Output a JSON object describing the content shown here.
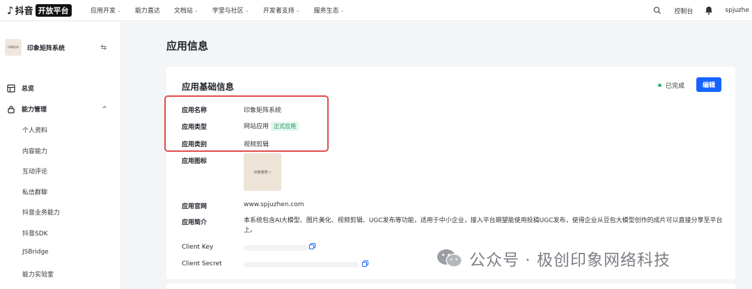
{
  "topbar": {
    "logo_note": "♪",
    "brand": "抖音",
    "platform": "开放平台",
    "nav": [
      {
        "label": "应用开发",
        "has_menu": true
      },
      {
        "label": "能力直达",
        "has_menu": false
      },
      {
        "label": "文档站",
        "has_menu": true
      },
      {
        "label": "学堂与社区",
        "has_menu": true
      },
      {
        "label": "开发者支持",
        "has_menu": true
      },
      {
        "label": "服务生态",
        "has_menu": true
      }
    ],
    "search_icon": "search-icon",
    "console": "控制台",
    "user": "spjuzhe"
  },
  "sidebar": {
    "app_thumb_text": "印象矩阵",
    "app_name": "印象矩阵系统",
    "overview": "总览",
    "group": "能力管理",
    "collapse_glyph": "^",
    "items": [
      "个人资料",
      "内容能力",
      "互动评论",
      "私信群聊",
      "抖音业务能力",
      "抖音SDK",
      "JSBridge",
      "能力实验室"
    ]
  },
  "main": {
    "page_title": "应用信息",
    "section_title": "应用基础信息",
    "status": "已完成",
    "status_color": "#2fb46e",
    "edit_button": "编辑",
    "accent_color": "#1664ff",
    "fields": {
      "name_label": "应用名称",
      "name_value": "印象矩阵系统",
      "type_label": "应用类型",
      "type_value": "网站应用",
      "type_tag": "正式应用",
      "category_label": "应用类别",
      "category_value": "视频剪辑",
      "icon_label": "应用图标",
      "icon_text": "印象矩阵 ♪",
      "site_label": "应用官网",
      "site_value": "www.spjuzhen.com",
      "intro_label": "应用简介",
      "intro_value": "本系统包含AI大模型、图片美化、视频剪辑、UGC发布等功能，适用于中小企业，接入平台期望能使用投稿UGC发布，使得企业从豆包大模型创作的成片可以直接分享至平台上。",
      "key_label": "Client Key",
      "secret_label": "Client Secret"
    },
    "highlight_color": "#e04a4a"
  },
  "watermark": {
    "text": "公众号 · 极创印象网络科技"
  }
}
